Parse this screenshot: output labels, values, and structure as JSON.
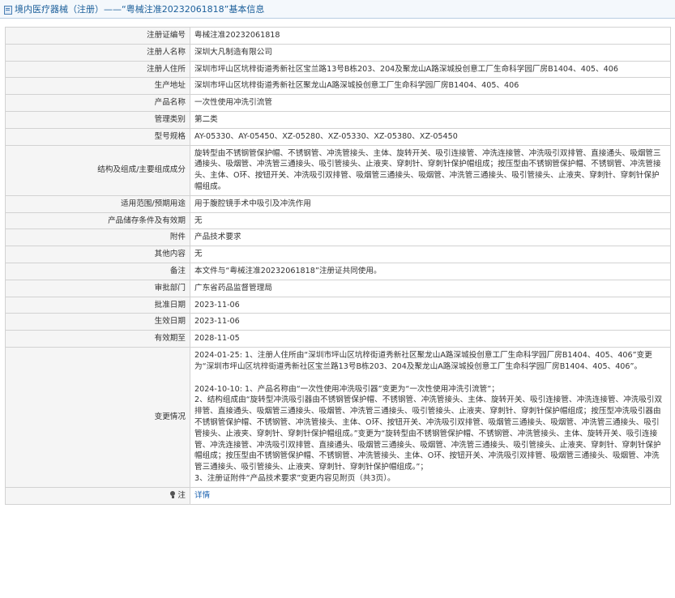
{
  "header": {
    "title": "境内医疗器械（注册）——“粤械注准20232061818”基本信息"
  },
  "rows": [
    {
      "label": "注册证编号",
      "value": "粤械注准20232061818"
    },
    {
      "label": "注册人名称",
      "value": "深圳大凡制造有限公司"
    },
    {
      "label": "注册人住所",
      "value": "深圳市坪山区坑梓街道秀新社区宝兰路13号B栋203、204及聚龙山A路深城投创意工厂生命科学园厂房B1404、405、406"
    },
    {
      "label": "生产地址",
      "value": "深圳市坪山区坑梓街道秀新社区聚龙山A路深城投创意工厂生命科学园厂房B1404、405、406"
    },
    {
      "label": "产品名称",
      "value": "一次性使用冲洗引流管"
    },
    {
      "label": "管理类别",
      "value": "第二类"
    },
    {
      "label": "型号规格",
      "value": "AY-05330、AY-05450、XZ-05280、XZ-05330、XZ-05380、XZ-05450"
    },
    {
      "label": "结构及组成/主要组成成分",
      "value": "旋转型由不锈钢管保护帽、不锈钢管、冲洗管接头、主体、旋转开关、吸引连接管、冲洗连接管、冲洗吸引双排管、直接通头、吸烟管三通接头、吸烟管、冲洗管三通接头、吸引管接头、止液夹、穿刺针、穿刺针保护帽组成；按压型由不锈钢管保护帽、不锈钢管、冲洗管接头、主体、O环、按钮开关、冲洗吸引双排管、吸烟管三通接头、吸烟管、冲洗管三通接头、吸引管接头、止液夹、穿刺针、穿刺针保护帽组成。"
    },
    {
      "label": "适用范围/预期用途",
      "value": "用于腹腔镜手术中吸引及冲洗作用"
    },
    {
      "label": "产品储存条件及有效期",
      "value": "无"
    },
    {
      "label": "附件",
      "value": "产品技术要求"
    },
    {
      "label": "其他内容",
      "value": "无"
    },
    {
      "label": "备注",
      "value": "本文件与“粤械注准20232061818”注册证共同使用。"
    },
    {
      "label": "审批部门",
      "value": "广东省药品监督管理局"
    },
    {
      "label": "批准日期",
      "value": "2023-11-06"
    },
    {
      "label": "生效日期",
      "value": "2023-11-06"
    },
    {
      "label": "有效期至",
      "value": "2028-11-05"
    }
  ],
  "changes": {
    "label": "变更情况",
    "p1": "2024-01-25: 1、注册人住所由“深圳市坪山区坑梓街道秀新社区聚龙山A路深城投创意工厂生命科学园厂房B1404、405、406”变更为“深圳市坪山区坑梓街道秀新社区宝兰路13号B栋203、204及聚龙山A路深城投创意工厂生命科学园厂房B1404、405、406”。",
    "p2a": "2024-10-10: 1、产品名称由“一次性使用冲洗吸引器”变更为“一次性使用冲洗引流管”；",
    "p2b": "2、结构组成由“旋转型冲洗吸引器由不锈钢管保护帽、不锈钢管、冲洗管接头、主体、旋转开关、吸引连接管、冲洗连接管、冲洗吸引双排管、直接通头、吸烟管三通接头、吸烟管、冲洗管三通接头、吸引管接头、止液夹、穿刺针、穿刺针保护帽组成；按压型冲洗吸引器由不锈钢管保护帽、不锈钢管、冲洗管接头、主体、O环、按钮开关、冲洗吸引双排管、吸烟管三通接头、吸烟管、冲洗管三通接头、吸引管接头、止液夹、穿刺针、穿刺针保护帽组成。”变更为“旋转型由不锈钢管保护帽、不锈钢管、冲洗管接头、主体、旋转开关、吸引连接管、冲洗连接管、冲洗吸引双排管、直接通头、吸烟管三通接头、吸烟管、冲洗管三通接头、吸引管接头、止液夹、穿刺针、穿刺针保护帽组成；按压型由不锈钢管保护帽、不锈钢管、冲洗管接头、主体、O环、按钮开关、冲洗吸引双排管、吸烟管三通接头、吸烟管、冲洗管三通接头、吸引管接头、止液夹、穿刺针、穿刺针保护帽组成。”；",
    "p2c": "3、注册证附件“产品技术要求”变更内容见附页（共3页）。"
  },
  "footer_row": {
    "label": "注",
    "link": "详情"
  },
  "colors": {
    "title": "#1a5e9a",
    "label_bg": "#f5f5f5",
    "border": "#d2d2d2",
    "link": "#1a62b0"
  },
  "icons": [
    "document-icon",
    "lightbulb-icon"
  ]
}
